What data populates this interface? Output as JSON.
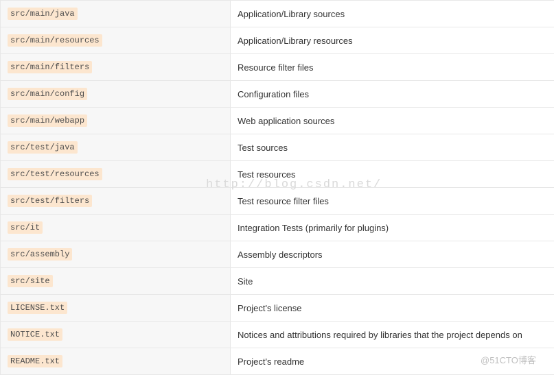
{
  "watermark": "http://blog.csdn.net/",
  "attribution": "@51CTO博客",
  "rows": [
    {
      "path": "src/main/java",
      "desc": "Application/Library sources"
    },
    {
      "path": "src/main/resources",
      "desc": "Application/Library resources"
    },
    {
      "path": "src/main/filters",
      "desc": "Resource filter files"
    },
    {
      "path": "src/main/config",
      "desc": "Configuration files"
    },
    {
      "path": "src/main/webapp",
      "desc": "Web application sources"
    },
    {
      "path": "src/test/java",
      "desc": "Test sources"
    },
    {
      "path": "src/test/resources",
      "desc": "Test resources"
    },
    {
      "path": "src/test/filters",
      "desc": "Test resource filter files"
    },
    {
      "path": "src/it",
      "desc": "Integration Tests (primarily for plugins)"
    },
    {
      "path": "src/assembly",
      "desc": "Assembly descriptors"
    },
    {
      "path": "src/site",
      "desc": "Site"
    },
    {
      "path": "LICENSE.txt",
      "desc": "Project's license"
    },
    {
      "path": "NOTICE.txt",
      "desc": "Notices and attributions required by libraries that the project depends on"
    },
    {
      "path": "README.txt",
      "desc": "Project's readme"
    }
  ]
}
